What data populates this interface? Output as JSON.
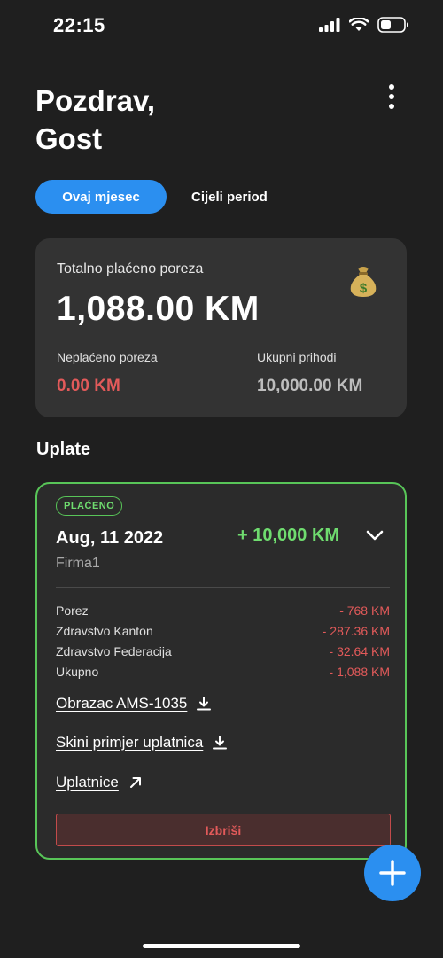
{
  "status_bar": {
    "time": "22:15"
  },
  "header": {
    "greeting": "Pozdrav,\nGost"
  },
  "tabs": [
    {
      "label": "Ovaj mjesec",
      "active": true
    },
    {
      "label": "Cijeli period",
      "active": false
    }
  ],
  "summary": {
    "total_label": "Totalno plaćeno poreza",
    "total_value": "1,088.00 KM",
    "icon": "money-bag-icon",
    "unpaid_label": "Neplaćeno poreza",
    "unpaid_value": "0.00 KM",
    "income_label": "Ukupni prihodi",
    "income_value": "10,000.00 KM"
  },
  "payments_section": {
    "title": "Uplate"
  },
  "payment": {
    "status": "PLAĆENO",
    "date": "Aug, 11 2022",
    "amount": "+ 10,000 KM",
    "company": "Firma1",
    "breakdown": [
      {
        "label": "Porez",
        "value": "- 768 KM"
      },
      {
        "label": "Zdravstvo Kanton",
        "value": "- 287.36 KM"
      },
      {
        "label": "Zdravstvo Federacija",
        "value": "- 32.64 KM"
      },
      {
        "label": "Ukupno",
        "value": "- 1,088 KM"
      }
    ],
    "links": {
      "form": "Obrazac AMS-1035",
      "sample": "Skini primjer uplatnica",
      "payslips": "Uplatnice"
    },
    "delete_label": "Izbriši"
  },
  "colors": {
    "background": "#1f1f1f",
    "accent": "#2b8ff0",
    "success": "#58c558",
    "danger": "#e25a5a",
    "card": "#333333"
  }
}
